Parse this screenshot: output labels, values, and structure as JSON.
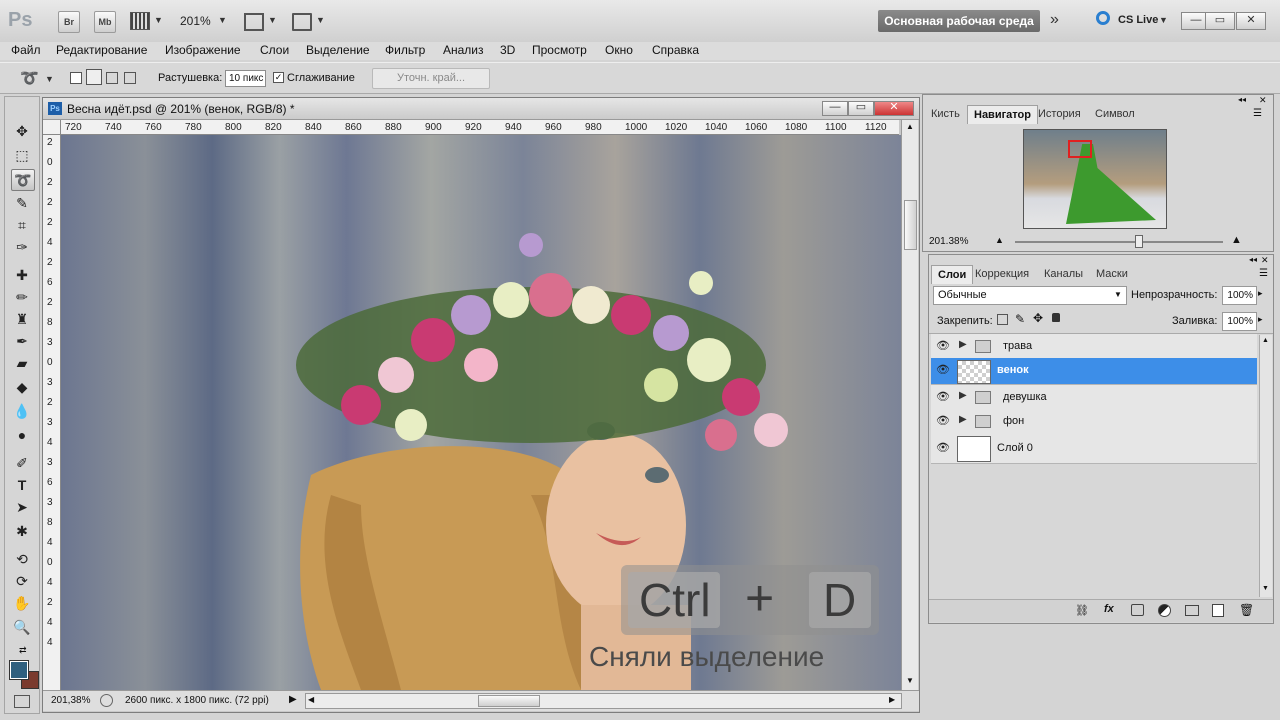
{
  "app": {
    "logo": "Ps",
    "bridge_label": "Br",
    "minibridge_label": "Mb",
    "zoom": "201%",
    "workspace": "Основная рабочая среда",
    "cslive": "CS Live"
  },
  "menu": [
    "Файл",
    "Редактирование",
    "Изображение",
    "Слои",
    "Выделение",
    "Фильтр",
    "Анализ",
    "3D",
    "Просмотр",
    "Окно",
    "Справка"
  ],
  "options": {
    "feather_label": "Растушевка:",
    "feather_value": "10 пикс",
    "antialias_label": "Сглаживание",
    "refine_label": "Уточн. край..."
  },
  "document": {
    "title": "Весна идёт.psd @ 201% (венок, RGB/8) *",
    "ruler_top": [
      "720",
      "740",
      "760",
      "780",
      "800",
      "820",
      "840",
      "860",
      "880",
      "900",
      "920",
      "940",
      "960",
      "980",
      "1000",
      "1020",
      "1040",
      "1060",
      "1080",
      "1100",
      "1120"
    ],
    "ruler_left": [
      "2",
      "0",
      "2",
      "2",
      "2",
      "4",
      "2",
      "6",
      "2",
      "8",
      "3",
      "0",
      "3",
      "2",
      "3",
      "4",
      "3",
      "6",
      "3",
      "8",
      "4",
      "0",
      "4",
      "2",
      "4",
      "4"
    ],
    "zoom": "201,38%",
    "doc_info": "2600 пикс. x 1800 пикс. (72 ppi)",
    "overlay_keys": [
      "Ctrl",
      "+",
      "D"
    ],
    "overlay_caption": "Сняли выделение"
  },
  "navigator": {
    "tabs": [
      "Кисть",
      "Навигатор",
      "История",
      "Символ"
    ],
    "zoom": "201.38%"
  },
  "layers": {
    "tabs": [
      "Слои",
      "Коррекция",
      "Каналы",
      "Маски"
    ],
    "blend_mode": "Обычные",
    "opacity_label": "Непрозрачность:",
    "opacity_value": "100%",
    "lock_label": "Закрепить:",
    "fill_label": "Заливка:",
    "fill_value": "100%",
    "items": [
      {
        "name": "трава",
        "type": "group"
      },
      {
        "name": "венок",
        "type": "layer",
        "selected": true
      },
      {
        "name": "девушка",
        "type": "group"
      },
      {
        "name": "фон",
        "type": "group"
      },
      {
        "name": "Слой 0",
        "type": "layer"
      }
    ]
  },
  "colors": {
    "accent_selection": "#3d8ee8",
    "foreground": "#2f5f7e",
    "background": "#7a3a2e"
  }
}
